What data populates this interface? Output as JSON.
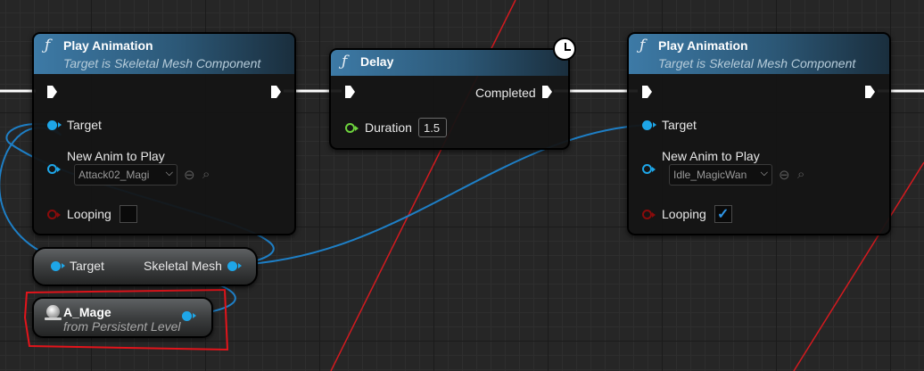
{
  "nodes": {
    "play_animation_1": {
      "title": "Play Animation",
      "subtitle": "Target is Skeletal Mesh Component",
      "fn_glyph": "ƒ",
      "pins": {
        "target": "Target",
        "new_anim": "New Anim to Play",
        "new_anim_value": "Attack02_Magi",
        "looping": "Looping",
        "looping_checked": false
      }
    },
    "delay": {
      "title": "Delay",
      "fn_glyph": "ƒ",
      "pins": {
        "completed": "Completed",
        "duration": "Duration",
        "duration_value": "1.5"
      }
    },
    "play_animation_2": {
      "title": "Play Animation",
      "subtitle": "Target is Skeletal Mesh Component",
      "fn_glyph": "ƒ",
      "pins": {
        "target": "Target",
        "new_anim": "New Anim to Play",
        "new_anim_value": "Idle_MagicWan",
        "looping": "Looping",
        "looping_checked": true
      }
    },
    "get_skeletal_mesh": {
      "target": "Target",
      "output": "Skeletal Mesh"
    },
    "actor_reference": {
      "title": "A_Mage",
      "subtitle": "from Persistent Level"
    }
  },
  "glyphs": {
    "dropdown": "⌵",
    "reset_icon": "⊖",
    "browse_icon": "⌕",
    "check": "✓"
  },
  "colors": {
    "exec_wire": "#ffffff",
    "object_pin": "#1ea6e8",
    "bool_pin": "#8a0b0b",
    "float_pin": "#6dd33d",
    "annotation": "#e3141b",
    "header_blue": "#3d7aa6"
  }
}
